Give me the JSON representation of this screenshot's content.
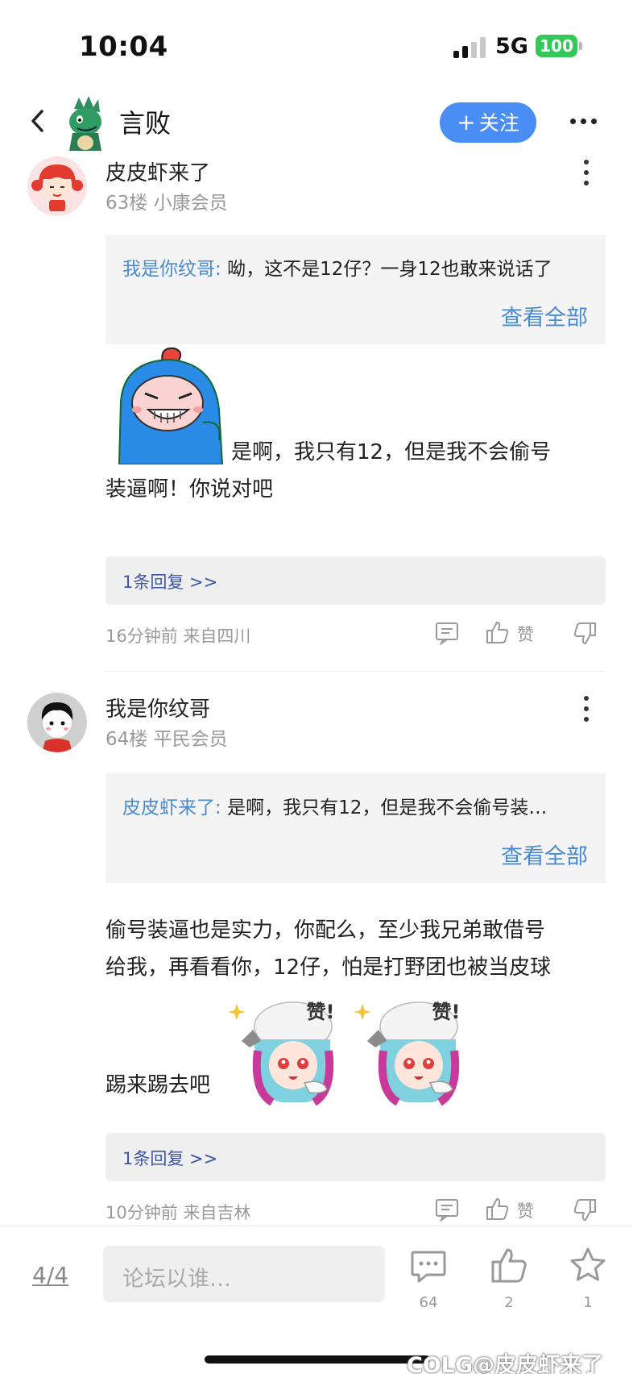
{
  "status_bar": {
    "time": "10:04",
    "network": "5G",
    "battery": "100"
  },
  "header": {
    "title": "言败",
    "follow_label": "关注"
  },
  "posts": [
    {
      "username": "皮皮虾来了",
      "meta": "63楼  小康会员",
      "quote_name": "我是你纹哥:",
      "quote_text": "呦，这不是12仔？一身12也敢来说话了",
      "see_all": "查看全部",
      "text_line1": "是啊，我只有12，但是我不会偷号",
      "text_line2": "装逼啊！你说对吧",
      "reply_link": "1条回复 >>",
      "time_location": "16分钟前 来自四川",
      "like_label": "赞"
    },
    {
      "username": "我是你纹哥",
      "meta": "64楼  平民会员",
      "quote_name": "皮皮虾来了:",
      "quote_text": "是啊，我只有12，但是我不会偷号装…",
      "see_all": "查看全部",
      "text_line1": "偷号装逼也是实力，你配么，至少我兄弟敢借号",
      "text_line2": "给我，再看看你，12仔，怕是打野团也被当皮球",
      "text_line3": "踢来踢去吧",
      "sticker_text": "赞!",
      "reply_link": "1条回复 >>",
      "time_location": "10分钟前 来自吉林",
      "like_label": "赞"
    }
  ],
  "bottom_bar": {
    "page": "4/4",
    "input_placeholder": "论坛以谁…",
    "comment_count": "64",
    "like_count": "2",
    "favorite_count": "1"
  },
  "watermark": "@皮皮虾来了",
  "colors": {
    "accent": "#4a8df5",
    "link": "#4a8ad0",
    "reply": "#3f55a8",
    "battery": "#34c759"
  }
}
